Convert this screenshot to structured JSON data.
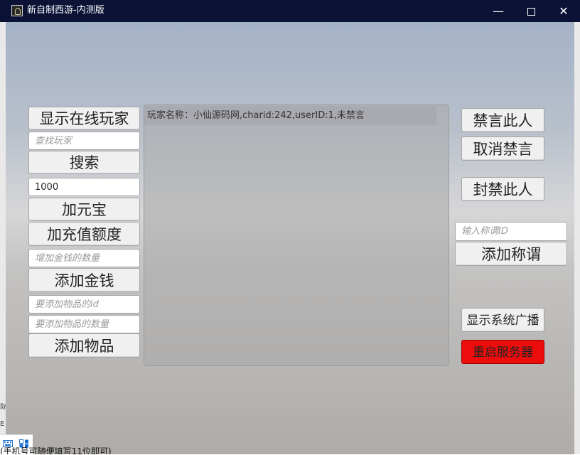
{
  "window": {
    "title": "新自制西游-内测版",
    "minimize": "—",
    "close": "✕"
  },
  "left_panel": {
    "show_online_players": "显示在线玩家",
    "search_player_placeholder": "查找玩家",
    "search_button": "搜索",
    "amount_value": "1000",
    "add_yuanbao": "加元宝",
    "add_recharge": "加充值额度",
    "gold_amount_placeholder": "增加金钱的数量",
    "add_gold": "添加金钱",
    "item_id_placeholder": "要添加物品的id",
    "item_count_placeholder": "要添加物品的数量",
    "add_item": "添加物品"
  },
  "player_list": {
    "rows": [
      "玩家名称：小仙源码网,charid:242,userID:1,未禁言"
    ]
  },
  "right_panel": {
    "mute_player": "禁言此人",
    "unmute_player": "取消禁言",
    "ban_player": "封禁此人",
    "title_id_placeholder": "输入称谓ID",
    "add_title": "添加称谓",
    "show_broadcast": "显示系统广播",
    "restart_server": "重启服务器"
  },
  "background": {
    "bottom_text": "(手机号可随便填写11位即可)",
    "left_text_1": "际",
    "left_text_2": "E"
  },
  "colors": {
    "restart_button": "#ee0d0d",
    "titlebar": "#0b1236"
  }
}
